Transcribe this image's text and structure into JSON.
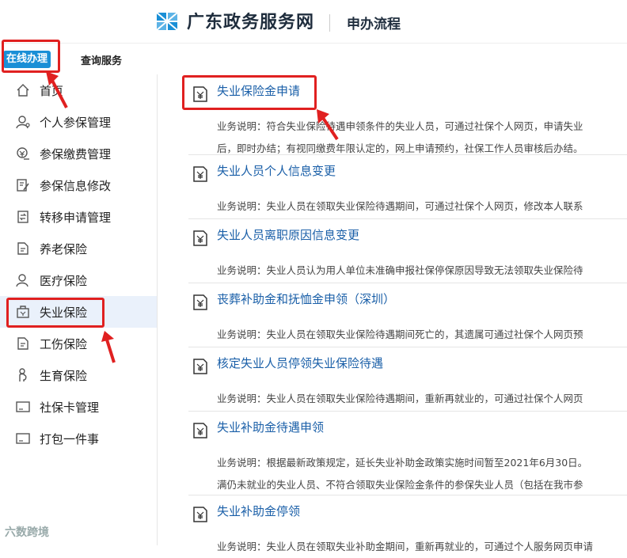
{
  "header": {
    "site_name": "广东政务服务网",
    "sub_title": "申办流程"
  },
  "tabs": {
    "online": "在线办理",
    "query": "查询服务"
  },
  "sidebar": {
    "items": [
      {
        "label": "首页",
        "icon": "home-icon"
      },
      {
        "label": "个人参保管理",
        "icon": "person-icon"
      },
      {
        "label": "参保缴费管理",
        "icon": "payment-icon"
      },
      {
        "label": "参保信息修改",
        "icon": "edit-icon"
      },
      {
        "label": "转移申请管理",
        "icon": "transfer-icon"
      },
      {
        "label": "养老保险",
        "icon": "document-icon"
      },
      {
        "label": "医疗保险",
        "icon": "medical-person-icon"
      },
      {
        "label": "失业保险",
        "icon": "briefcase-icon"
      },
      {
        "label": "工伤保险",
        "icon": "document-icon"
      },
      {
        "label": "生育保险",
        "icon": "maternity-icon"
      },
      {
        "label": "社保卡管理",
        "icon": "card-icon"
      },
      {
        "label": "打包一件事",
        "icon": "card-icon"
      }
    ],
    "active_index": 7
  },
  "services": [
    {
      "title": "失业保险金申请",
      "desc": [
        "业务说明：符合失业保险待遇申领条件的失业人员，可通过社保个人网页，申请失业",
        "后，即时办结；有视同缴费年限认定的，网上申请预约，社保工作人员审核后办结。"
      ]
    },
    {
      "title": "失业人员个人信息变更",
      "desc": [
        "业务说明：失业人员在领取失业保险待遇期间，可通过社保个人网页，修改本人联系"
      ]
    },
    {
      "title": "失业人员离职原因信息变更",
      "desc": [
        "业务说明：失业人员认为用人单位未准确申报社保停保原因导致无法领取失业保险待"
      ]
    },
    {
      "title": "丧葬补助金和抚恤金申领（深圳）",
      "desc": [
        "业务说明：失业人员在领取失业保险待遇期间死亡的，其遗属可通过社保个人网页预"
      ]
    },
    {
      "title": "核定失业人员停领失业保险待遇",
      "desc": [
        "业务说明：失业人员在领取失业保险待遇期间，重新再就业的，可通过社保个人网页"
      ]
    },
    {
      "title": "失业补助金待遇申领",
      "desc": [
        "业务说明：根据最新政策规定，延长失业补助金政策实施时间暂至2021年6月30日。",
        "满仍未就业的失业人员、不符合领取失业保险金条件的参保失业人员（包括在我市参"
      ]
    },
    {
      "title": "失业补助金停领",
      "desc": [
        "业务说明：失业人员在领取失业补助金期间，重新再就业的，可通过个人服务网页申请"
      ]
    }
  ],
  "watermark": "六数跨境",
  "colors": {
    "accent": "#1a8fd6",
    "link": "#1a5fa8",
    "highlight": "#e02020",
    "active_bg": "#eaf1fb"
  }
}
